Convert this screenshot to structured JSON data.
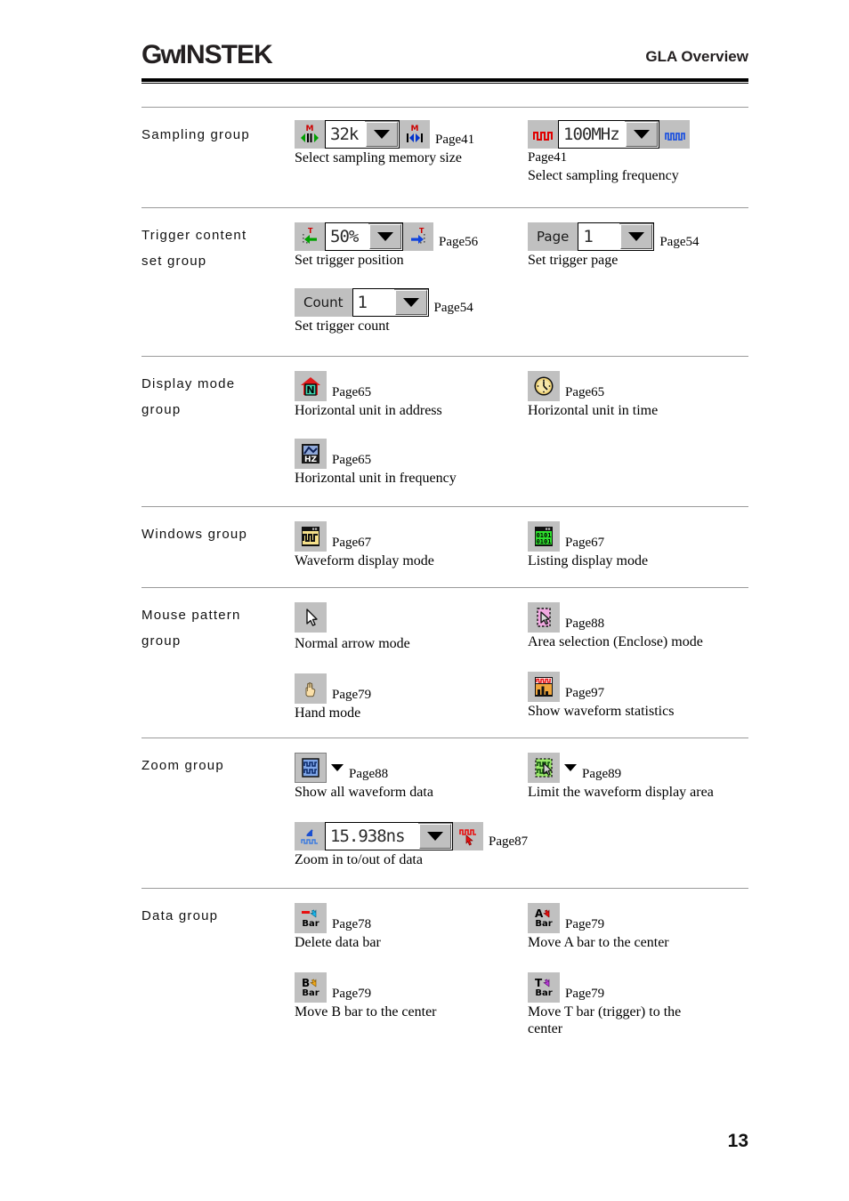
{
  "header": {
    "logo_gw": "Gᴡ",
    "logo_instek": "INSTEK",
    "title": "GLA Overview"
  },
  "footer": {
    "page_number": "13"
  },
  "groups": [
    {
      "label": "Sampling group",
      "left": [
        {
          "widget": "combo-with-buttons",
          "value": "32k",
          "pageref": "Page41",
          "caption": "Select sampling memory size",
          "icons": [
            "memory-size-left-icon",
            "memory-size-right-icon"
          ]
        }
      ],
      "right": [
        {
          "widget": "combo-with-buttons",
          "value": "100MHz",
          "pageref": "Page41",
          "caption": "Select sampling frequency",
          "icons": [
            "red-waveform-icon",
            "blue-waveform-icon"
          ]
        }
      ]
    },
    {
      "label": "Trigger content set group",
      "left": [
        {
          "widget": "combo-with-buttons",
          "value": "50%",
          "pageref": "Page56",
          "caption": "Set trigger position",
          "icons": [
            "trigger-left-arrow-icon",
            "trigger-right-arrow-icon"
          ]
        },
        {
          "widget": "labeled-combo",
          "field_label": "Count",
          "value": "1",
          "pageref": "Page54",
          "caption": "Set trigger count"
        }
      ],
      "right": [
        {
          "widget": "labeled-combo",
          "field_label": "Page",
          "value": "1",
          "pageref": "Page54",
          "caption": "Set trigger page"
        }
      ]
    },
    {
      "label": "Display mode group",
      "left": [
        {
          "widget": "icon",
          "icon": "house-address-icon",
          "pageref": "Page65",
          "caption": "Horizontal unit in address"
        },
        {
          "widget": "icon",
          "icon": "hz-frequency-icon",
          "pageref": "Page65",
          "caption": "Horizontal unit in frequency"
        }
      ],
      "right": [
        {
          "widget": "icon",
          "icon": "clock-time-icon",
          "pageref": "Page65",
          "caption": "Horizontal unit in time"
        }
      ]
    },
    {
      "label": "Windows group",
      "left": [
        {
          "widget": "icon",
          "icon": "waveform-window-icon",
          "pageref": "Page67",
          "caption": "Waveform display mode"
        }
      ],
      "right": [
        {
          "widget": "icon",
          "icon": "listing-window-icon",
          "pageref": "Page67",
          "caption": "Listing display mode"
        }
      ]
    },
    {
      "label": "Mouse pattern group",
      "left": [
        {
          "widget": "icon",
          "icon": "arrow-cursor-icon",
          "pageref": "",
          "caption": "Normal arrow mode"
        },
        {
          "widget": "icon",
          "icon": "hand-cursor-icon",
          "pageref": "Page79",
          "caption": "Hand mode"
        }
      ],
      "right": [
        {
          "widget": "icon",
          "icon": "area-selection-icon",
          "pageref": "Page88",
          "caption": "Area selection (Enclose) mode"
        },
        {
          "widget": "icon",
          "icon": "waveform-statistics-icon",
          "pageref": "Page97",
          "caption": "Show waveform statistics"
        }
      ]
    },
    {
      "label": "Zoom group",
      "left": [
        {
          "widget": "icon-dropdown",
          "icon": "show-all-waveform-icon",
          "pageref": "Page88",
          "caption": "Show all waveform data"
        },
        {
          "widget": "combo-with-buttons",
          "value": "15.938ns",
          "pageref": "Page87",
          "caption": "Zoom in to/out of data",
          "icons": [
            "zoom-out-icon",
            "zoom-select-icon"
          ]
        }
      ],
      "right": [
        {
          "widget": "icon-dropdown",
          "icon": "limit-display-area-icon",
          "pageref": "Page89",
          "caption": "Limit the waveform display area"
        }
      ]
    },
    {
      "label": "Data group",
      "left": [
        {
          "widget": "icon",
          "icon": "delete-data-bar-icon",
          "pageref": "Page78",
          "caption": "Delete data bar"
        },
        {
          "widget": "icon",
          "icon": "move-b-bar-icon",
          "pageref": "Page79",
          "caption": "Move B bar to the center"
        }
      ],
      "right": [
        {
          "widget": "icon",
          "icon": "move-a-bar-icon",
          "pageref": "Page79",
          "caption": "Move A bar to the center"
        },
        {
          "widget": "icon",
          "icon": "move-t-bar-icon",
          "pageref": "Page79",
          "caption": "Move T bar (trigger) to the center"
        }
      ]
    }
  ]
}
